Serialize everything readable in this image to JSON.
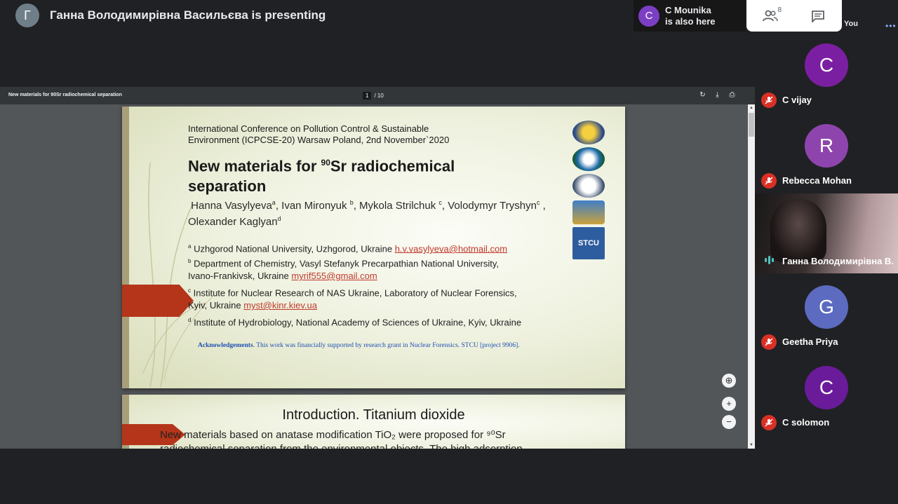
{
  "presenter": {
    "avatar_letter": "Г",
    "text": "Ганна Володимирівна Васильєва is presenting"
  },
  "also_here": {
    "avatar_letter": "C",
    "name": "C Mounika",
    "subtitle": "is also here"
  },
  "top_panel": {
    "people_count": "8",
    "you_label": "You",
    "people_icon": "people-icon",
    "chat_icon": "chat-icon",
    "more_icon": "more-options-icon"
  },
  "pdf": {
    "title": "New materials for 90Sr radiochemical separation",
    "page": "1",
    "total_pages": "/ 10"
  },
  "slide1": {
    "conference_line1": "International Conference on Pollution Control & Sustainable",
    "conference_line2": "Environment (ICPCSE-20) Warsaw Poland, 2nd November`2020",
    "title_prefix": "New materials for ",
    "title_sup": "90",
    "title_suffix": "Sr radiochemical separation",
    "author1": "Hanna Vasylyeva",
    "author1_sup": "a",
    "author2": ", Ivan Mironyuk ",
    "author2_sup": "b",
    "author3": ", Mykola Strilchuk ",
    "author3_sup": "c",
    "author4": ", Volodymyr Tryshyn",
    "author4_sup": "c",
    "author5": " , Olexander Kaglyan",
    "author5_sup": "d",
    "affil_a_sup": "a",
    "affil_a": " Uzhgorod National University, Uzhgorod, Ukraine ",
    "affil_a_email": "h.v.vasylyeva@hotmail.com",
    "affil_b_sup": "b",
    "affil_b1": " Department of Chemistry, Vasyl Stefanyk Precarpathian National University,",
    "affil_b2": "Ivano-Frankivsk, Ukraine ",
    "affil_b_email": "myrif555@gmail.com",
    "affil_c_sup": "c",
    "affil_c1": " Institute for Nuclear Research of NAS Ukraine, Laboratory of Nuclear Forensics,",
    "affil_c2": "Kyiv, Ukraine ",
    "affil_c_email": "myst@kinr.kiev.ua",
    "affil_d_sup": "d",
    "affil_d": " Institute of Hydrobiology, National Academy of Sciences of Ukraine, Kyiv, Ukraine",
    "ack_bold": "Acknowledgements",
    "ack_text": ". This work was financially supported by research grant in Nuclear Forensics. STCU [project 9906].",
    "logo_last_text": "STCU"
  },
  "slide2": {
    "title": "Introduction. Titanium dioxide",
    "body_line1": "New materials based on anatase modification TiO₂ were proposed for ⁹⁰Sr",
    "body_line2": "radiochemical separation from the environmental objects. The high adsorption"
  },
  "participants": [
    {
      "letter": "C",
      "name": "C vijay",
      "color": "#7b1fa2",
      "muted": true
    },
    {
      "letter": "R",
      "name": "Rebecca Mohan",
      "color": "#8e44ad",
      "muted": true
    },
    {
      "letter": "",
      "name": "Ганна Володимирівна В...",
      "color": "",
      "muted": false
    },
    {
      "letter": "G",
      "name": "Geetha Priya",
      "color": "#5c6bc0",
      "muted": true
    },
    {
      "letter": "C",
      "name": "C solomon",
      "color": "#6a1b9a",
      "muted": true
    }
  ],
  "colors": {
    "background": "#202124",
    "accent_red": "#b43519",
    "mic_off": "#d93025"
  }
}
